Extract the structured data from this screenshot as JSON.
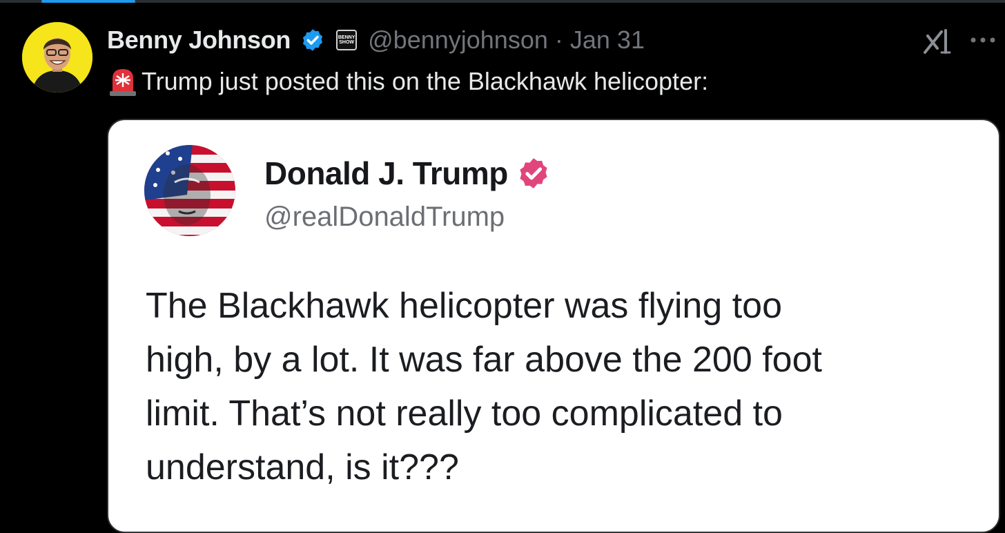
{
  "post": {
    "author": {
      "display_name": "Benny Johnson",
      "handle": "@bennyjohnson",
      "affiliate_badge_text": "BENNY SHOW"
    },
    "separator": "·",
    "date": "Jan 31",
    "text": "Trump just posted this on the Blackhawk helicopter:",
    "icons": [
      "avatar",
      "verified-badge-icon",
      "affiliate-badge",
      "grok-icon",
      "more-icon",
      "siren-icon"
    ]
  },
  "quoted_image": {
    "name": "Donald J. Trump",
    "handle": "@realDonaldTrump",
    "body_lines": [
      "The Blackhawk helicopter was flying too",
      "high, by a lot. It was far above the 200 foot",
      "limit. That’s not really too complicated to",
      "understand, is it???"
    ]
  },
  "colors": {
    "background": "#000000",
    "primary_text": "#e7e9ea",
    "secondary_text": "#71767b",
    "verified_blue": "#1d9bf0",
    "verified_pink": "#e0457b",
    "card_background": "#ffffff"
  }
}
